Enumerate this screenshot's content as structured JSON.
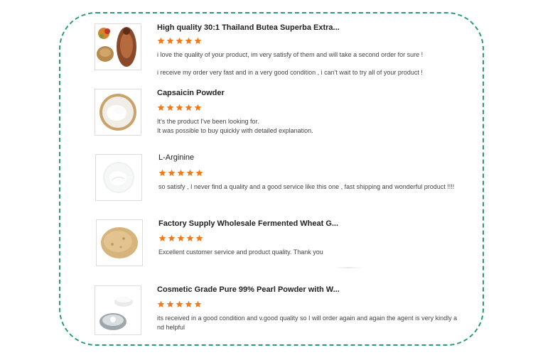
{
  "colors": {
    "star": "#f07a1e",
    "frame": "#2a9a7a"
  },
  "reviews": [
    {
      "title": "High quality 30:1 Thailand Butea Superba Extra...",
      "rating": 5,
      "lines": [
        "i love the quality of your product, im very satisfy of them and will take a second order for sure !",
        "",
        "i receive my order very fast and in a very good condition , i can't wait to try all of your product !"
      ]
    },
    {
      "title": "Capsaicin Powder",
      "rating": 5,
      "lines": [
        "It's the product I've been looking for.",
        "It was possible to buy quickly with detailed explanation."
      ]
    },
    {
      "title": "L-Arginine",
      "rating": 5,
      "lines": [
        "so satisfy , I never find a quality and a good service like this one , fast shipping and wonderful product !!!!"
      ]
    },
    {
      "title": "Factory Supply Wholesale Fermented Wheat G...",
      "rating": 5,
      "lines": [
        "Excellent customer service and product quality. Thank you"
      ]
    },
    {
      "title": "Cosmetic Grade Pure 99% Pearl Powder with W...",
      "rating": 5,
      "lines": [
        "its received in a good condition and v.good  quality so I will order again and again the agent is very kindly a",
        "nd helpful"
      ]
    }
  ]
}
